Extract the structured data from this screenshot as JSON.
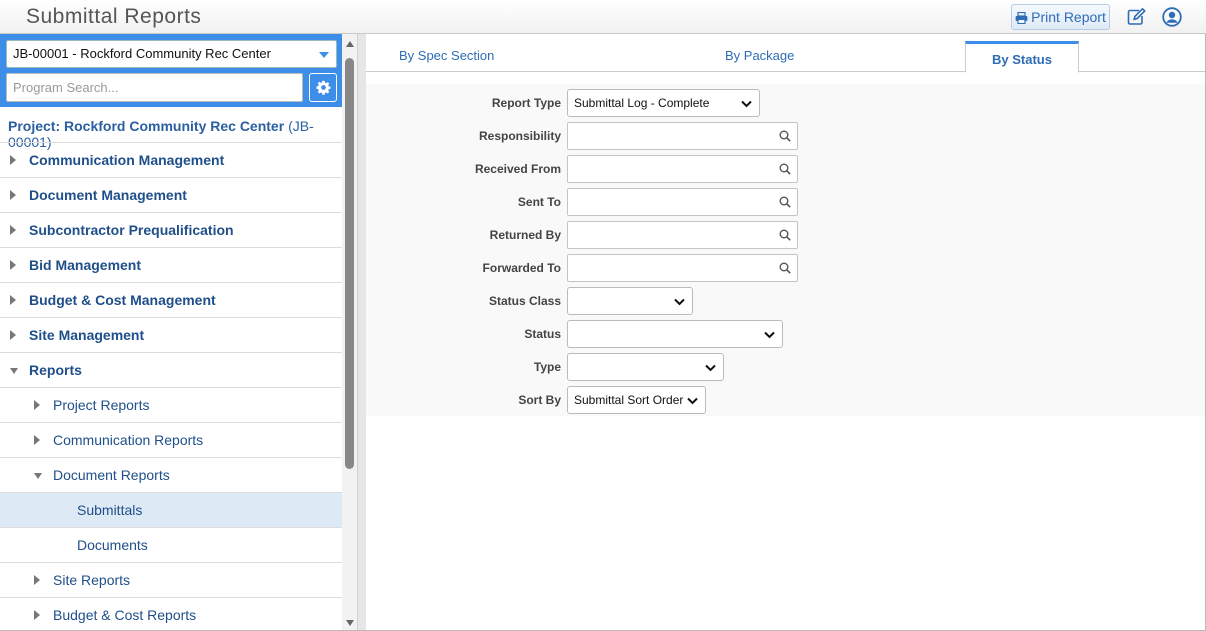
{
  "header": {
    "title": "Submittal Reports",
    "print_label": "Print Report"
  },
  "sidebar": {
    "job_select": "JB-00001 - Rockford Community Rec Center",
    "search_placeholder": "Program Search...",
    "project_label": "Project: Rockford Community Rec Center",
    "project_job": "(JB-00001)",
    "items": [
      {
        "label": "Communication Management",
        "level": 0,
        "expanded": false
      },
      {
        "label": "Document Management",
        "level": 0,
        "expanded": false
      },
      {
        "label": "Subcontractor Prequalification",
        "level": 0,
        "expanded": false
      },
      {
        "label": "Bid Management",
        "level": 0,
        "expanded": false
      },
      {
        "label": "Budget & Cost Management",
        "level": 0,
        "expanded": false
      },
      {
        "label": "Site Management",
        "level": 0,
        "expanded": false
      },
      {
        "label": "Reports",
        "level": 0,
        "expanded": true
      },
      {
        "label": "Project Reports",
        "level": 1,
        "expanded": false
      },
      {
        "label": "Communication Reports",
        "level": 1,
        "expanded": false
      },
      {
        "label": "Document Reports",
        "level": 1,
        "expanded": true
      },
      {
        "label": "Submittals",
        "level": 2,
        "selected": true
      },
      {
        "label": "Documents",
        "level": 2
      },
      {
        "label": "Site Reports",
        "level": 1,
        "expanded": false
      },
      {
        "label": "Budget & Cost Reports",
        "level": 1,
        "expanded": false
      }
    ]
  },
  "main": {
    "tabs": [
      {
        "label": "By Spec Section",
        "active": false
      },
      {
        "label": "By Package",
        "active": false
      },
      {
        "label": "By Status",
        "active": true
      }
    ],
    "form": {
      "report_type": {
        "label": "Report Type",
        "value": "Submittal Log - Complete"
      },
      "responsibility": {
        "label": "Responsibility",
        "value": ""
      },
      "received_from": {
        "label": "Received From",
        "value": ""
      },
      "sent_to": {
        "label": "Sent To",
        "value": ""
      },
      "returned_by": {
        "label": "Returned By",
        "value": ""
      },
      "forwarded_to": {
        "label": "Forwarded To",
        "value": ""
      },
      "status_class": {
        "label": "Status Class",
        "value": ""
      },
      "status": {
        "label": "Status",
        "value": ""
      },
      "type": {
        "label": "Type",
        "value": ""
      },
      "sort_by": {
        "label": "Sort By",
        "value": "Submittal Sort Order"
      }
    }
  },
  "colors": {
    "accent": "#3c8ee8",
    "link": "#2e6db5",
    "nav_text": "#1f4f8a",
    "selected_row": "#dde9f5"
  }
}
